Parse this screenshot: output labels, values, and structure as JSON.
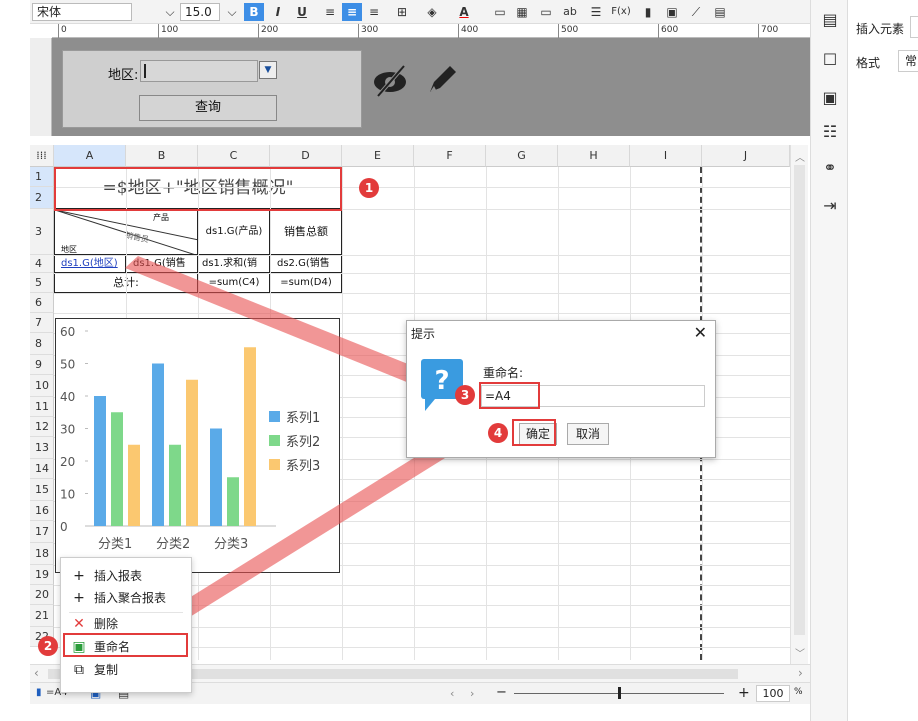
{
  "toolbar": {
    "font_family": "宋体",
    "font_size": "15.0",
    "bold": "B",
    "italic": "I",
    "underline": "U",
    "text_ab": "ab",
    "fx": "F(x)",
    "font_color": "A"
  },
  "ruler": {
    "ticks": [
      "0",
      "100",
      "200",
      "300",
      "400",
      "500",
      "600",
      "700"
    ]
  },
  "form": {
    "area_label": "地区:",
    "query_button": "查询"
  },
  "sheet": {
    "columns": [
      "A",
      "B",
      "C",
      "D",
      "E",
      "F",
      "G",
      "H",
      "I",
      "J"
    ],
    "rows": [
      "1",
      "2",
      "3",
      "4",
      "5",
      "6",
      "7",
      "8",
      "9",
      "10",
      "11",
      "12",
      "13",
      "14",
      "15",
      "16",
      "17",
      "18",
      "19",
      "20",
      "21",
      "22"
    ],
    "title_formula": "=$地区+\"地区销售概况\"",
    "diag_top": "产品",
    "diag_mid": "销售员",
    "diag_bottom": "地区",
    "c3": "ds1.G(产品)",
    "d3": "销售总额",
    "a4": "ds1.G(地区)",
    "b4": "ds1.G(销售",
    "c4": "ds1.求和(销",
    "d4": "ds2.G(销售",
    "total_label": "总计:",
    "c5": "=sum(C4)",
    "d5": "=sum(D4)"
  },
  "chart_data": {
    "type": "bar",
    "categories": [
      "分类1",
      "分类2",
      "分类3"
    ],
    "y_ticks": [
      "0",
      "10",
      "20",
      "30",
      "40",
      "50",
      "60"
    ],
    "ylim": [
      0,
      60
    ],
    "series": [
      {
        "name": "系列1",
        "values": [
          40,
          50,
          30
        ],
        "color": "#5aaae8"
      },
      {
        "name": "系列2",
        "values": [
          35,
          25,
          15
        ],
        "color": "#7ed88a"
      },
      {
        "name": "系列3",
        "values": [
          25,
          45,
          55
        ],
        "color": "#fbc870"
      }
    ],
    "legend": "right",
    "grid": false
  },
  "dialog": {
    "title": "提示",
    "close": "✕",
    "label": "重命名:",
    "value": "=A4",
    "ok": "确定",
    "cancel": "取消"
  },
  "context_menu": {
    "items": [
      "插入报表",
      "插入聚合报表",
      "删除",
      "重命名",
      "复制"
    ]
  },
  "right_panel": {
    "insert_element": "插入元素",
    "format": "格式",
    "format_value": "常"
  },
  "status": {
    "cell_ref": "=A4",
    "zoom": "100",
    "percent": "%"
  },
  "callouts": [
    "1",
    "2",
    "3",
    "4"
  ]
}
